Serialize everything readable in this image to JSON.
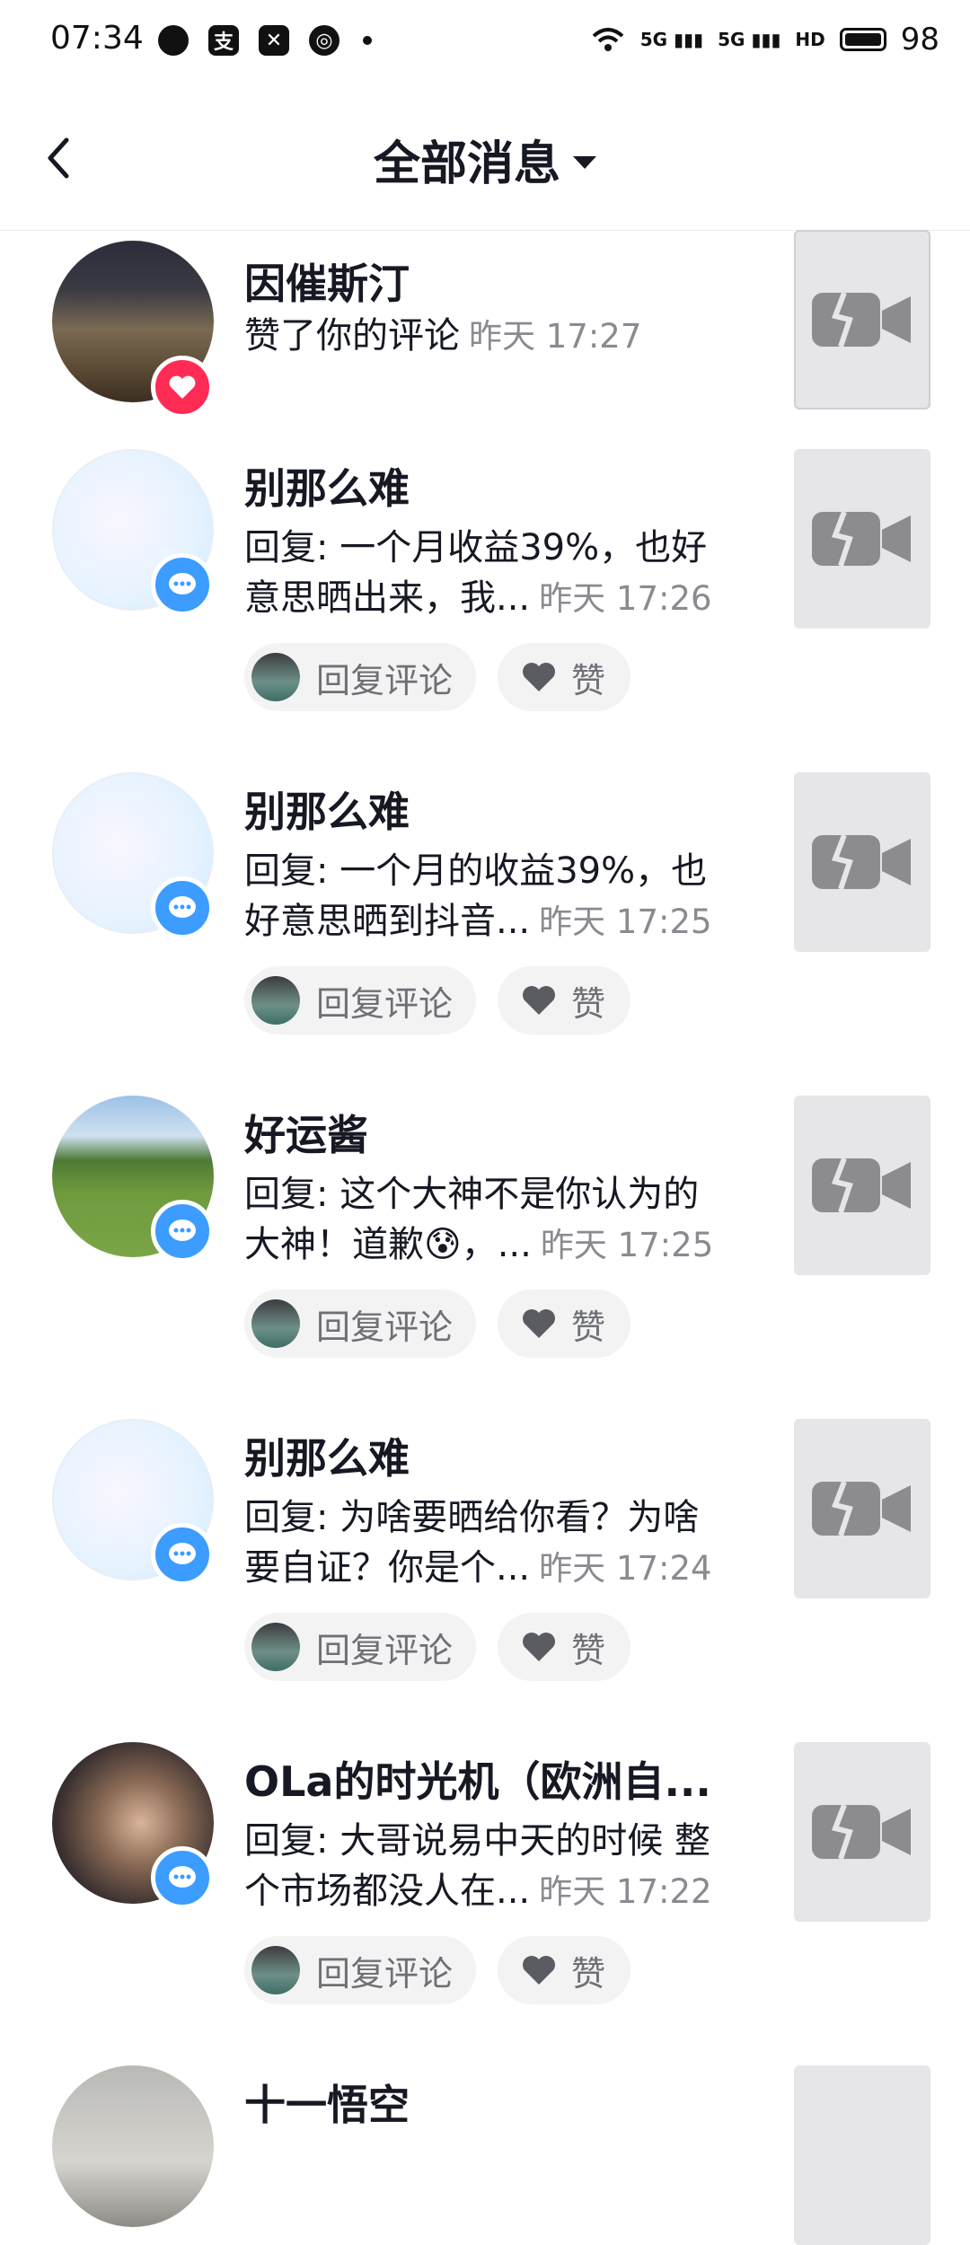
{
  "status_bar": {
    "time": "07:34",
    "network": "5G",
    "hd": "HD",
    "battery": "98"
  },
  "header": {
    "title": "全部消息"
  },
  "actions": {
    "reply_label": "回复评论",
    "like_label": "赞"
  },
  "items": [
    {
      "name": "因催斯汀",
      "line1": "赞了你的评论",
      "line2": "",
      "time": "昨天 17:27",
      "badge": "like"
    },
    {
      "name": "别那么难",
      "line1": "回复: 一个月收益39%，也好",
      "line2": "意思晒出来，我...",
      "time": "昨天 17:26",
      "badge": "comment"
    },
    {
      "name": "别那么难",
      "line1": "回复: 一个月的收益39%，也",
      "line2": "好意思晒到抖音...",
      "time": "昨天 17:25",
      "badge": "comment"
    },
    {
      "name": "好运酱",
      "line1": "回复: 这个大神不是你认为的",
      "line2": "大神！道歉😰，...",
      "time": "昨天 17:25",
      "badge": "comment"
    },
    {
      "name": "别那么难",
      "line1": "回复: 为啥要晒给你看？为啥",
      "line2": "要自证？你是个...",
      "time": "昨天 17:24",
      "badge": "comment"
    },
    {
      "name": "OLa的时光机（欧洲自...",
      "line1": "回复: 大哥说易中天的时候 整",
      "line2": "个市场都没人在...",
      "time": "昨天 17:22",
      "badge": "comment"
    },
    {
      "name": "十一悟空",
      "line1": "",
      "line2": "",
      "time": "",
      "badge": "comment"
    }
  ]
}
